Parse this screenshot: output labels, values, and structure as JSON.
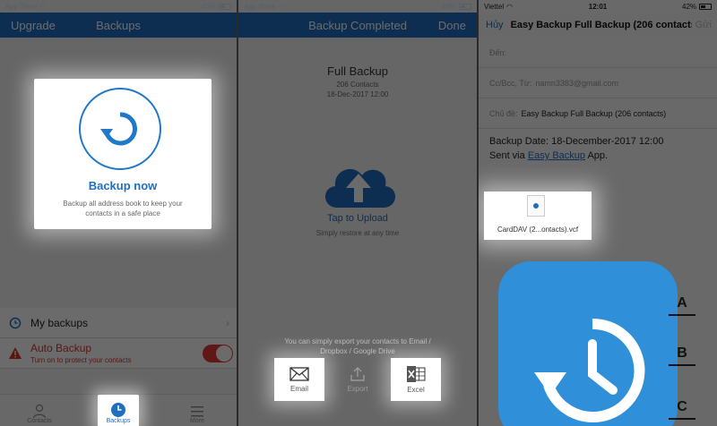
{
  "panel1": {
    "status": {
      "carrier": "App Store",
      "battery": "43%"
    },
    "nav": {
      "left": "Upgrade",
      "title": "Backups"
    },
    "card": {
      "title": "Backup now",
      "desc": "Backup all address book to keep your contacts in a safe place"
    },
    "my_backups": "My backups",
    "auto_backup": {
      "title": "Auto Backup",
      "subtitle": "Turn on to protect your contacts"
    },
    "tabs": [
      {
        "label": "Contacts"
      },
      {
        "label": "Backups"
      },
      {
        "label": "More"
      }
    ]
  },
  "panel2": {
    "status": {
      "carrier": "App Store",
      "battery": "43%"
    },
    "nav": {
      "title": "Backup Completed",
      "right": "Done"
    },
    "title": "Full Backup",
    "contacts": "206 Contacts",
    "date": "18-Dec-2017 12:00",
    "tap_upload": "Tap to Upload",
    "restore": "Simply restore at any time",
    "export_note": "You can simply export your contacts to Email / Dropbox / Google Drive",
    "buttons": [
      {
        "label": "Email"
      },
      {
        "label": "Export"
      },
      {
        "label": "Excel"
      }
    ]
  },
  "panel3": {
    "status": {
      "carrier": "Viettel",
      "time": "12:01",
      "battery": "42%"
    },
    "cancel": "Hủy",
    "subject_bar": "Easy Backup Full Backup (206 contacts)",
    "send": "Gửi",
    "to_label": "Đến:",
    "cc_label": "Cc/Bcc, Từ:",
    "cc_value": "namn3383@gmail.com",
    "subject_label": "Chủ đề:",
    "subject_value": "Easy Backup Full Backup (206 contacts)",
    "body_date": "Backup Date: 18-December-2017 12:00",
    "body_sent_prefix": "Sent via ",
    "body_link": "Easy Backup",
    "body_sent_suffix": " App.",
    "attachment": "CardDAV (2...ontacts).vcf",
    "letters": [
      "A",
      "B",
      "C"
    ]
  },
  "colors": {
    "brand": "#1f6fc0",
    "alert": "#e53935"
  }
}
